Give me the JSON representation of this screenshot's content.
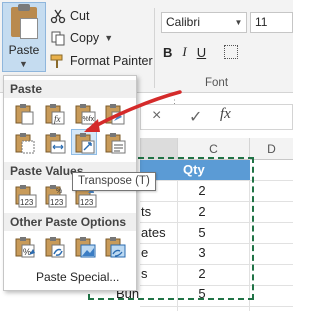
{
  "ribbon": {
    "paste_label": "Paste",
    "cut_label": "Cut",
    "copy_label": "Copy",
    "format_painter_label": "Format Painter",
    "font_name": "Calibri",
    "font_size": "11",
    "bold": "B",
    "italic": "I",
    "underline": "U",
    "font_group_label": "Font"
  },
  "paste_menu": {
    "sections": {
      "paste": "Paste",
      "paste_values": "Paste Values",
      "other": "Other Paste Options"
    },
    "paste_icons": [
      {
        "icon": "paste-icon"
      },
      {
        "icon": "paste-formulas-icon",
        "glyph": "fx"
      },
      {
        "icon": "paste-formulas-number-format-icon",
        "glyph": "%fx"
      },
      {
        "icon": "keep-source-formatting-icon"
      },
      {
        "icon": "no-borders-icon"
      },
      {
        "icon": "keep-column-widths-icon"
      },
      {
        "icon": "transpose-icon"
      },
      {
        "icon": "paste-link-icon"
      }
    ],
    "value_icons": [
      {
        "icon": "paste-values-icon",
        "glyph": "123"
      },
      {
        "icon": "values-number-format-icon",
        "glyph": "%123"
      },
      {
        "icon": "values-source-format-icon",
        "glyph": "123"
      }
    ],
    "other_icons": [
      {
        "icon": "paste-formatting-icon",
        "glyph": "%"
      },
      {
        "icon": "paste-link-icon"
      },
      {
        "icon": "paste-picture-icon"
      },
      {
        "icon": "linked-picture-icon"
      }
    ],
    "paste_special": "Paste Special...",
    "tooltip": "Transpose (T)"
  },
  "formula_bar": {
    "cancel": "×",
    "enter": "✓",
    "fx": "fx"
  },
  "sheet": {
    "columns": [
      "C",
      "D"
    ],
    "header": "Qty",
    "rows": [
      {
        "b_text": "",
        "qty": "2"
      },
      {
        "b_text": "ts",
        "qty": "2"
      },
      {
        "b_text": "ates",
        "qty": "5"
      },
      {
        "b_text": "e",
        "qty": "3"
      },
      {
        "b_text": "s",
        "qty": "2"
      },
      {
        "b_text": "Bun",
        "qty": "5"
      }
    ]
  },
  "colors": {
    "accent": "#217346",
    "header_fill": "#5b9bd5",
    "arrow": "#d42a2a",
    "highlight": "#d5e8f8"
  }
}
